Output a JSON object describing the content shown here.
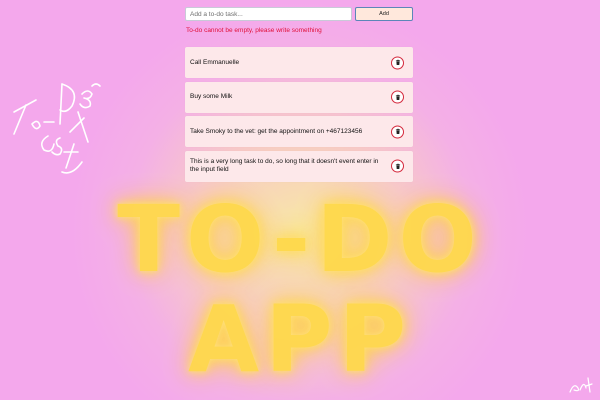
{
  "background": {
    "title_line1": "TO-DO",
    "title_line2": "APP",
    "accent_color": "#ffd94a"
  },
  "form": {
    "input_placeholder": "Add a to-do task...",
    "input_value": "",
    "add_label": "Add"
  },
  "error": {
    "message": "To-do cannot be empty, please write something",
    "color": "#e0113a"
  },
  "todos": [
    {
      "text": "Call Emmanuelle",
      "delete_icon": "trash-icon"
    },
    {
      "text": "Buy some Milk",
      "delete_icon": "trash-icon"
    },
    {
      "text": "Take Smoky to the vet: get the appointment on +467123456",
      "delete_icon": "trash-icon"
    },
    {
      "text": "This is a very long task to do, so long that it doesn't event enter in the input field",
      "delete_icon": "trash-icon"
    }
  ]
}
